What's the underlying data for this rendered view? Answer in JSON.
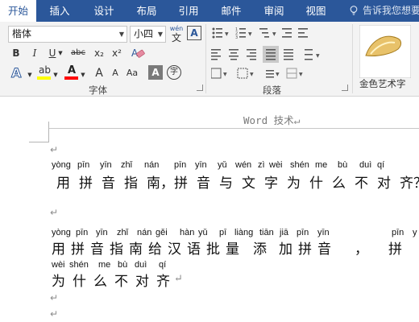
{
  "tabs": [
    {
      "label": "开始",
      "active": true
    },
    {
      "label": "插入"
    },
    {
      "label": "设计"
    },
    {
      "label": "布局"
    },
    {
      "label": "引用"
    },
    {
      "label": "邮件"
    },
    {
      "label": "审阅"
    },
    {
      "label": "视图"
    }
  ],
  "tell_me": "告诉我您想要",
  "ribbon": {
    "font_name": "楷体",
    "font_size": "小四",
    "phonetic_guide_top": "wén",
    "phonetic_guide_bottom": "文",
    "bold": "B",
    "italic": "I",
    "underline": "U",
    "strike": "abc",
    "subscript": "x₂",
    "superscript": "x²",
    "char_shading": "A",
    "enclose": "字",
    "text_effects": "A",
    "highlight": "ab",
    "font_color": "A",
    "grow_font": "A",
    "shrink_font": "A",
    "change_case": "Aa",
    "char_border": "A",
    "group_font": "字体",
    "group_paragraph": "段落",
    "wordart_label": "金色艺术字",
    "colors": {
      "highlight": "#ffff00",
      "font_color": "#ff0000",
      "accent": "#2b579a"
    }
  },
  "document": {
    "header": "Word 技术",
    "para_mark": "↵",
    "line1": {
      "pinyin": [
        "yòng",
        "pīn",
        "yīn",
        "zhǐ",
        "nán",
        "pīn",
        "yīn",
        "yǔ",
        "wén",
        "zì",
        "wèi",
        "shén",
        "me",
        "bù",
        "duì",
        "qí"
      ],
      "hanzi": [
        "用",
        "拼",
        "音",
        "指",
        "南，",
        "拼",
        "音",
        "与",
        "文",
        "字",
        "为",
        "什",
        "么",
        "不",
        "对",
        "齐？"
      ]
    },
    "line2": {
      "pinyin": [
        "yòng",
        "pīn",
        "yīn",
        "zhǐ",
        "nán",
        "gěi",
        "hàn",
        "yǔ",
        "pī",
        "liàng",
        "tiān",
        "jiā",
        "pīn",
        "yīn",
        "pīn",
        "y"
      ],
      "hanzi": [
        "用",
        "拼",
        "音",
        "指",
        "南",
        "给",
        "汉",
        "语",
        "批",
        "量",
        "添",
        "加",
        "拼",
        "音",
        "，",
        "拼"
      ]
    },
    "line3": {
      "pinyin": [
        "wèi",
        "shén",
        "me",
        "bù",
        "duì",
        "qí"
      ],
      "hanzi": [
        "为",
        "什",
        "么",
        "不",
        "对",
        "齐"
      ]
    }
  }
}
